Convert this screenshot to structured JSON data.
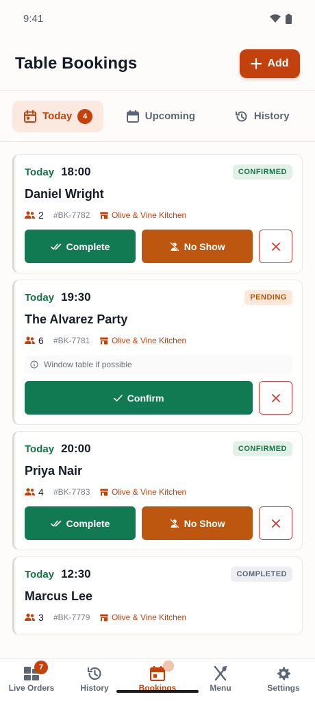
{
  "status_bar": {
    "time": "9:41"
  },
  "header": {
    "title": "Table Bookings",
    "add_label": "Add"
  },
  "tabs": [
    {
      "label": "Today",
      "badge": "4",
      "active": true
    },
    {
      "label": "Upcoming",
      "active": false
    },
    {
      "label": "History",
      "active": false
    }
  ],
  "bookings": [
    {
      "day": "Today",
      "time": "18:00",
      "status": "CONFIRMED",
      "name": "Daniel Wright",
      "party": "2",
      "ref": "#BK-7782",
      "venue": "Olive & Vine Kitchen",
      "actions": [
        "Complete",
        "No Show"
      ]
    },
    {
      "day": "Today",
      "time": "19:30",
      "status": "PENDING",
      "name": "The Alvarez Party",
      "party": "6",
      "ref": "#BK-7781",
      "venue": "Olive & Vine Kitchen",
      "note": "Window table if possible",
      "actions": [
        "Confirm"
      ]
    },
    {
      "day": "Today",
      "time": "20:00",
      "status": "CONFIRMED",
      "name": "Priya Nair",
      "party": "4",
      "ref": "#BK-7783",
      "venue": "Olive & Vine Kitchen",
      "actions": [
        "Complete",
        "No Show"
      ]
    },
    {
      "day": "Today",
      "time": "12:30",
      "status": "COMPLETED",
      "name": "Marcus Lee",
      "party": "3",
      "ref": "#BK-7779",
      "venue": "Olive & Vine Kitchen"
    }
  ],
  "bottom_nav": [
    {
      "label": "Live Orders",
      "icon": "grid-icon",
      "badge": "7"
    },
    {
      "label": "History",
      "icon": "history-icon"
    },
    {
      "label": "Bookings",
      "icon": "calendar-icon",
      "active": true
    },
    {
      "label": "Menu",
      "icon": "utensils-icon"
    },
    {
      "label": "Settings",
      "icon": "gear-icon"
    }
  ],
  "colors": {
    "accent": "#c2410c",
    "success": "#117a52",
    "warning": "#bd570f",
    "danger": "#d33b2e"
  }
}
